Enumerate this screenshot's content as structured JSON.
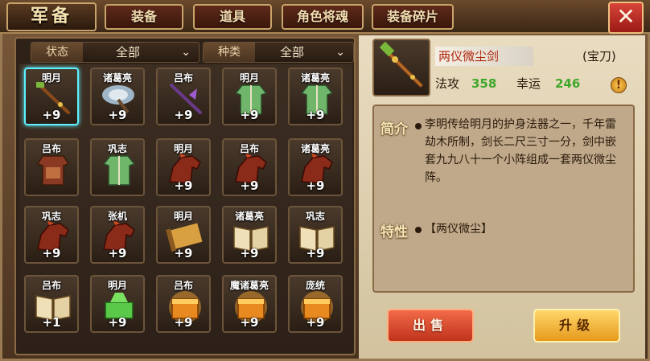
{
  "header": {
    "title": "军备",
    "tabs": [
      {
        "label": "装备",
        "active": true
      },
      {
        "label": "道具",
        "active": false
      },
      {
        "label": "角色将魂",
        "active": false
      },
      {
        "label": "装备碎片",
        "active": false
      }
    ],
    "close_icon": "close-x-icon"
  },
  "filters": {
    "status": {
      "label": "状态",
      "value": "全部"
    },
    "category": {
      "label": "种类",
      "value": "全部"
    }
  },
  "inventory": [
    {
      "owner": "明月",
      "level": "+9",
      "icon": "staff-icon",
      "selected": true
    },
    {
      "owner": "诸葛亮",
      "level": "+9",
      "icon": "feather-fan-icon"
    },
    {
      "owner": "吕布",
      "level": "+9",
      "icon": "halberd-icon"
    },
    {
      "owner": "明月",
      "level": "+9",
      "icon": "robe-icon"
    },
    {
      "owner": "诸葛亮",
      "level": "+9",
      "icon": "robe-icon"
    },
    {
      "owner": "吕布",
      "level": "",
      "icon": "armor-icon"
    },
    {
      "owner": "巩志",
      "level": "",
      "icon": "robe-icon"
    },
    {
      "owner": "明月",
      "level": "+9",
      "icon": "horse-icon"
    },
    {
      "owner": "吕布",
      "level": "+9",
      "icon": "horse-icon"
    },
    {
      "owner": "诸葛亮",
      "level": "+9",
      "icon": "horse-icon"
    },
    {
      "owner": "巩志",
      "level": "+9",
      "icon": "horse-icon"
    },
    {
      "owner": "张机",
      "level": "+9",
      "icon": "horse-icon"
    },
    {
      "owner": "明月",
      "level": "+9",
      "icon": "scroll-icon"
    },
    {
      "owner": "诸葛亮",
      "level": "+9",
      "icon": "book-icon"
    },
    {
      "owner": "巩志",
      "level": "+9",
      "icon": "book-icon"
    },
    {
      "owner": "吕布",
      "level": "+1",
      "icon": "book-icon"
    },
    {
      "owner": "明月",
      "level": "+9",
      "icon": "jade-seal-icon"
    },
    {
      "owner": "吕布",
      "level": "+9",
      "icon": "gold-seal-icon"
    },
    {
      "owner": "魔诸葛亮",
      "level": "+9",
      "icon": "gold-seal-icon"
    },
    {
      "owner": "庞统",
      "level": "+9",
      "icon": "gold-seal-icon"
    }
  ],
  "detail": {
    "name": "两仪微尘剑",
    "type": "(宝刀)",
    "stats": [
      {
        "label": "法攻",
        "value": "358"
      },
      {
        "label": "幸运",
        "value": "246"
      }
    ],
    "intro_title": "简介",
    "intro_text": "李明传给明月的护身法器之一，千年雷劫木所制，剑长二尺三寸一分，剑中嵌套九九八十一个小阵组成一套两仪微尘阵。",
    "feature_title": "特性",
    "feature_text": "【两仪微尘】"
  },
  "buttons": {
    "sell": "出售",
    "upgrade": "升级"
  },
  "colors": {
    "stat_value": "#3fa82a",
    "item_name": "#b02a10",
    "selected_border": "#5ef0ff"
  }
}
